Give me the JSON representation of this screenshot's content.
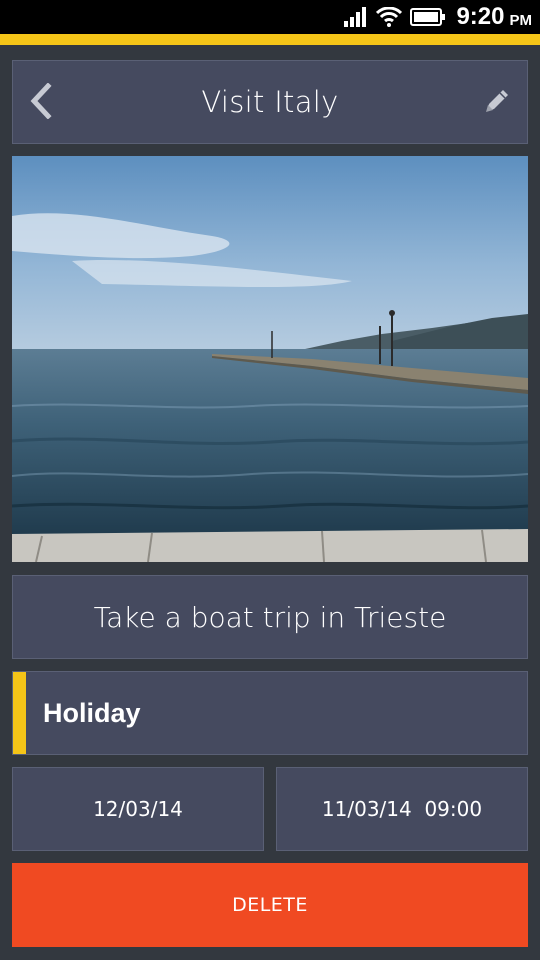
{
  "status_bar": {
    "time": "9:20",
    "ampm": "PM",
    "icons": [
      "signal-icon",
      "wifi-icon",
      "battery-icon"
    ]
  },
  "header": {
    "title": "Visit Italy",
    "back_icon": "chevron-left-icon",
    "edit_icon": "pencil-icon"
  },
  "task": {
    "title": "Take a boat trip in Trieste",
    "category": "Holiday",
    "date": "12/03/14",
    "reminder": "11/03/14  09:00"
  },
  "actions": {
    "delete_label": "DELETE"
  },
  "colors": {
    "accent": "#f5c518",
    "card": "#454a5f",
    "background": "#33383f",
    "delete": "#f04a22"
  }
}
